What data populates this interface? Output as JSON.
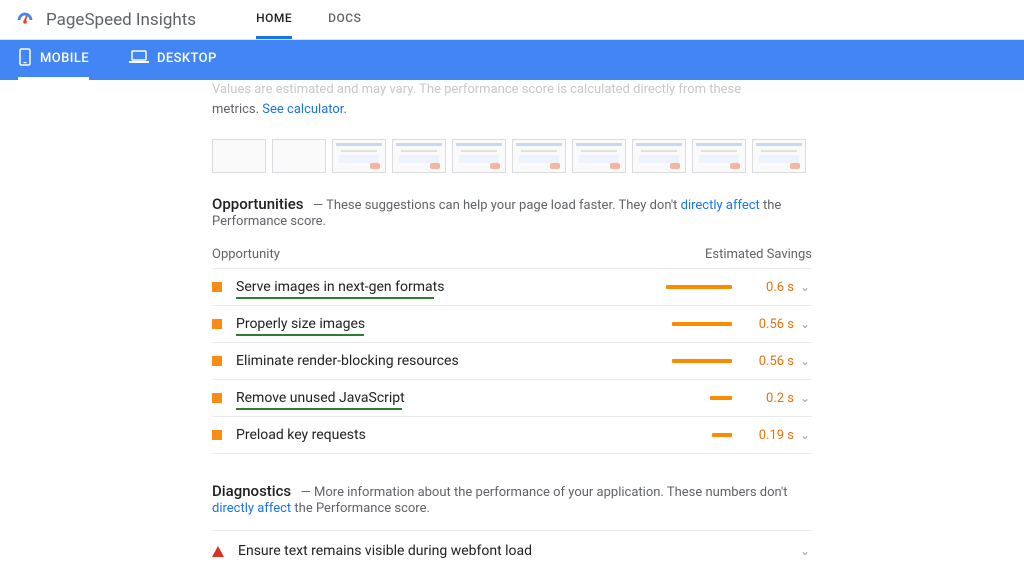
{
  "header": {
    "product": "PageSpeed Insights",
    "nav": {
      "home": "HOME",
      "docs": "DOCS"
    }
  },
  "bluebar": {
    "mobile": "MOBILE",
    "desktop": "DESKTOP"
  },
  "cutoff": {
    "blurred": "Values are estimated and may vary. The performance score is calculated directly from these",
    "plain": "metrics.",
    "link": "See calculator"
  },
  "thumbnail_count": 10,
  "opportunities": {
    "title": "Opportunities",
    "desc_pre": " — These suggestions can help your page load faster. They don't ",
    "desc_link": "directly affect",
    "desc_post": " the Performance score.",
    "col_left": "Opportunity",
    "col_right": "Estimated Savings",
    "items": [
      {
        "label": "Serve images in next-gen formats",
        "savings": "0.6 s",
        "bar": 66,
        "underline": 198
      },
      {
        "label": "Properly size images",
        "savings": "0.56 s",
        "bar": 60,
        "underline": 128
      },
      {
        "label": "Eliminate render-blocking resources",
        "savings": "0.56 s",
        "bar": 60,
        "underline": 0
      },
      {
        "label": "Remove unused JavaScript",
        "savings": "0.2 s",
        "bar": 22,
        "underline": 166
      },
      {
        "label": "Preload key requests",
        "savings": "0.19 s",
        "bar": 20,
        "underline": 0
      }
    ]
  },
  "diagnostics": {
    "title": "Diagnostics",
    "desc_pre": " — More information about the performance of your application. These numbers don't ",
    "desc_link": "directly affect",
    "desc_post": " the Performance score.",
    "items": [
      {
        "label": "Ensure text remains visible during webfont load"
      }
    ]
  }
}
